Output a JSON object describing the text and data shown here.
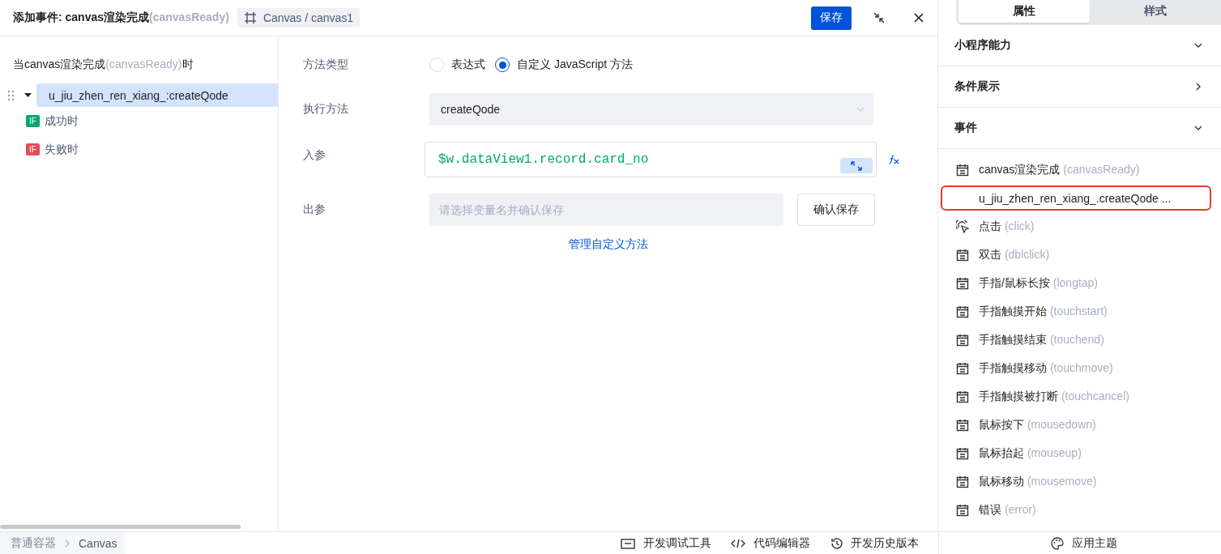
{
  "header": {
    "title": "添加事件: canvas渲染完成",
    "title_code": "(canvasReady)",
    "component_path": "Canvas / canvas1",
    "save": "保存"
  },
  "trigger": {
    "prefix": "当canvas渲染完成",
    "code": "(canvasReady)",
    "suffix": "时"
  },
  "tree": [
    {
      "label": "u_jiu_zhen_ren_xiang_:createQode",
      "selected": true,
      "expanded": true,
      "children": [
        {
          "badge": "IF",
          "label": "成功时",
          "color": "#00a870"
        },
        {
          "badge": "IF",
          "label": "失败时",
          "color": "#e34d59"
        }
      ]
    }
  ],
  "form": {
    "method_type": {
      "label": "方法类型",
      "options": [
        {
          "label": "表达式",
          "selected": false
        },
        {
          "label": "自定义 JavaScript 方法",
          "selected": true
        }
      ]
    },
    "method": {
      "label": "执行方法",
      "value": "createQode"
    },
    "input_params": {
      "label": "入参",
      "value": "$w.dataView1.record.card_no"
    },
    "output_params": {
      "label": "出参",
      "placeholder": "请选择变量名并确认保存",
      "button": "确认保存"
    },
    "manage_link": "管理自定义方法"
  },
  "panel": {
    "tabs": [
      {
        "label": "属性",
        "selected": true
      },
      {
        "label": "样式",
        "selected": false
      }
    ],
    "sections": [
      {
        "title": "小程序能力",
        "expanded": true
      },
      {
        "title": "条件展示",
        "expanded": false
      },
      {
        "title": "事件",
        "expanded": true
      }
    ],
    "events": [
      {
        "kind": "event",
        "name": "canvas渲染完成",
        "code": "(canvasReady)"
      },
      {
        "kind": "handler",
        "name": "u_jiu_zhen_ren_xiang_.createQode ...",
        "highlighted": true
      },
      {
        "kind": "click",
        "name": "点击",
        "code": "(click)"
      },
      {
        "kind": "event",
        "name": "双击",
        "code": "(dblclick)"
      },
      {
        "kind": "event",
        "name": "手指/鼠标长按",
        "code": "(longtap)"
      },
      {
        "kind": "event",
        "name": "手指触摸开始",
        "code": "(touchstart)"
      },
      {
        "kind": "event",
        "name": "手指触摸结束",
        "code": "(touchend)"
      },
      {
        "kind": "event",
        "name": "手指触摸移动",
        "code": "(touchmove)"
      },
      {
        "kind": "event",
        "name": "手指触摸被打断",
        "code": "(touchcancel)"
      },
      {
        "kind": "event",
        "name": "鼠标按下",
        "code": "(mousedown)"
      },
      {
        "kind": "event",
        "name": "鼠标抬起",
        "code": "(mouseup)"
      },
      {
        "kind": "event",
        "name": "鼠标移动",
        "code": "(mousemove)"
      },
      {
        "kind": "event",
        "name": "错误",
        "code": "(error)"
      }
    ]
  },
  "status_bar": {
    "breadcrumb": [
      "普通容器",
      "Canvas"
    ],
    "tools": [
      {
        "kind": "debug",
        "label": "开发调试工具"
      },
      {
        "kind": "code",
        "label": "代码编辑器"
      },
      {
        "kind": "history",
        "label": "开发历史版本"
      }
    ],
    "theme": "应用主题"
  }
}
